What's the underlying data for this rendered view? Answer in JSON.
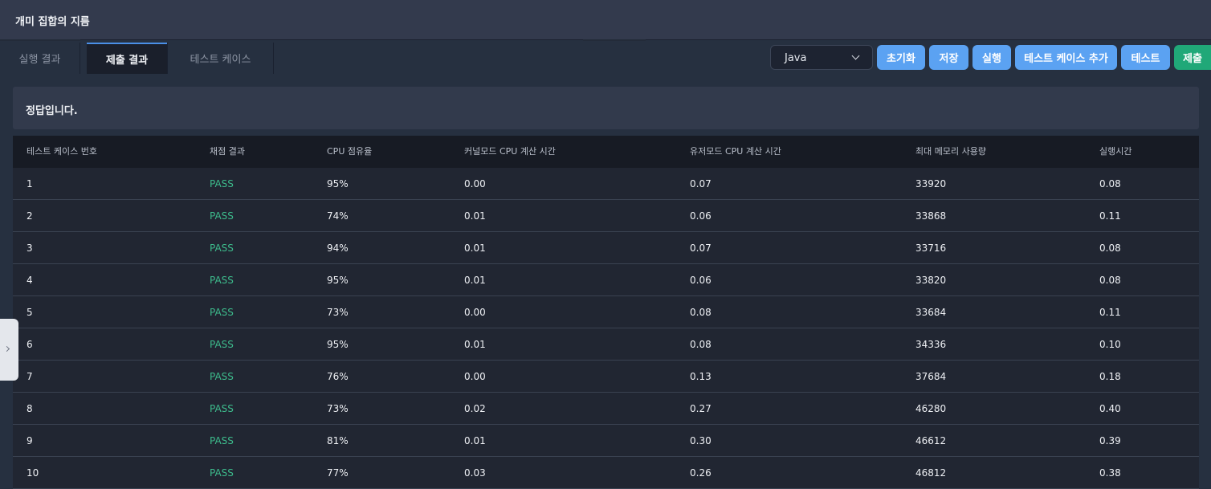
{
  "app": {
    "title": "개미 집합의 지름"
  },
  "tabs": [
    "실행 결과",
    "제출 결과",
    "테스트 케이스"
  ],
  "language": {
    "selected": "Java"
  },
  "buttons": {
    "reset": "초기화",
    "save": "저장",
    "run": "실행",
    "add_test_case": "테스트 케이스 추가",
    "test": "테스트",
    "submit": "제출"
  },
  "result": {
    "message": "정답입니다."
  },
  "table": {
    "headers": [
      "테스트 케이스 번호",
      "채점 결과",
      "CPU 점유율",
      "커널모드 CPU 계산 시간",
      "유저모드 CPU 계산 시간",
      "최대 메모리 사용량",
      "실행시간"
    ],
    "rows": [
      [
        "1",
        "PASS",
        "95%",
        "0.00",
        "0.07",
        "33920",
        "0.08"
      ],
      [
        "2",
        "PASS",
        "74%",
        "0.01",
        "0.06",
        "33868",
        "0.11"
      ],
      [
        "3",
        "PASS",
        "94%",
        "0.01",
        "0.07",
        "33716",
        "0.08"
      ],
      [
        "4",
        "PASS",
        "95%",
        "0.01",
        "0.06",
        "33820",
        "0.08"
      ],
      [
        "5",
        "PASS",
        "73%",
        "0.00",
        "0.08",
        "33684",
        "0.11"
      ],
      [
        "6",
        "PASS",
        "95%",
        "0.01",
        "0.08",
        "34336",
        "0.10"
      ],
      [
        "7",
        "PASS",
        "76%",
        "0.00",
        "0.13",
        "37684",
        "0.18"
      ],
      [
        "8",
        "PASS",
        "73%",
        "0.02",
        "0.27",
        "46280",
        "0.40"
      ],
      [
        "9",
        "PASS",
        "81%",
        "0.01",
        "0.30",
        "46612",
        "0.39"
      ],
      [
        "10",
        "PASS",
        "77%",
        "0.03",
        "0.26",
        "46812",
        "0.38"
      ]
    ]
  },
  "colors": {
    "accent": "#5ba2f2",
    "submit": "#20a878",
    "pass": "#3dbb8c"
  }
}
